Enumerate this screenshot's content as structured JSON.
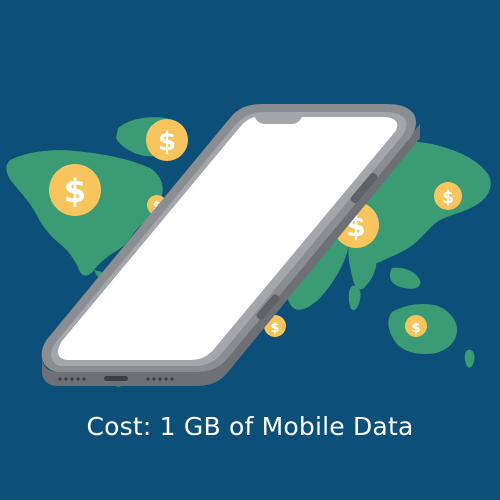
{
  "caption": "Cost: 1 GB of Mobile Data",
  "coin_symbol": "$",
  "colors": {
    "background": "#0c4f78",
    "land": "#3a9b74",
    "coin": "#f8c45d",
    "coin_symbol": "#ffffff",
    "phone_body": "#7a7d82",
    "phone_frame": "#9a9ea4",
    "phone_screen": "#ffffff",
    "caption_text": "#ffffff"
  },
  "icons": [
    "world-map-icon",
    "smartphone-icon",
    "dollar-coin-icon"
  ]
}
